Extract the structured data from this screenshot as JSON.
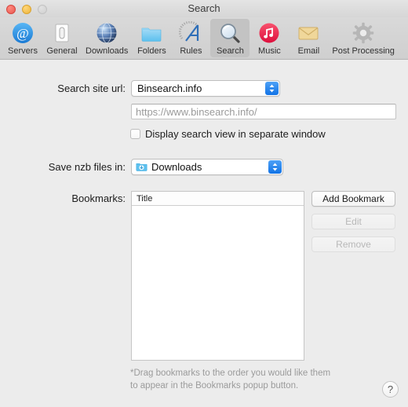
{
  "window": {
    "title": "Search",
    "controls": {
      "close": "close-button",
      "minimize": "minimize-button",
      "zoom": "zoom-button"
    }
  },
  "toolbar": {
    "selected": "Search",
    "items": [
      {
        "label": "Servers",
        "icon": "at-sign-icon"
      },
      {
        "label": "General",
        "icon": "switch-icon"
      },
      {
        "label": "Downloads",
        "icon": "globe-icon"
      },
      {
        "label": "Folders",
        "icon": "folder-icon"
      },
      {
        "label": "Rules",
        "icon": "ruler-triangle-icon"
      },
      {
        "label": "Search",
        "icon": "magnifier-icon"
      },
      {
        "label": "Music",
        "icon": "music-note-icon"
      },
      {
        "label": "Email",
        "icon": "envelope-icon"
      },
      {
        "label": "Post Processing",
        "icon": "gear-icon"
      }
    ]
  },
  "main": {
    "search_site": {
      "label": "Search site url:",
      "selected": "Binsearch.info",
      "options": [
        "Binsearch.info"
      ]
    },
    "url_field": {
      "value": "",
      "placeholder": "https://www.binsearch.info/"
    },
    "separate_window": {
      "label": "Display search view in separate window",
      "checked": false
    },
    "save_nzb": {
      "label": "Save nzb files in:",
      "selected": "Downloads",
      "icon": "downloads-folder-icon",
      "options": [
        "Downloads"
      ]
    },
    "bookmarks": {
      "label": "Bookmarks:",
      "column_header": "Title",
      "rows": [],
      "buttons": [
        {
          "label": "Add Bookmark",
          "enabled": true
        },
        {
          "label": "Edit",
          "enabled": false
        },
        {
          "label": "Remove",
          "enabled": false
        }
      ]
    },
    "footnote_line1": "*Drag bookmarks to the order you would like them",
    "footnote_line2": "to appear in the Bookmarks popup button.",
    "help": "?"
  },
  "colors": {
    "accent": "#1273e6",
    "toolbar_bg": "#d4d4d4",
    "content_bg": "#ececec",
    "disabled_text": "#b8b8b8"
  }
}
